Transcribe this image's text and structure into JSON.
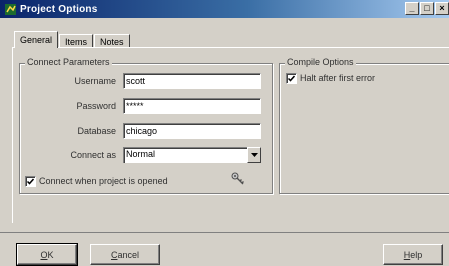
{
  "window": {
    "title": "Project Options",
    "min_glyph": "_",
    "max_glyph": "□",
    "close_glyph": "×"
  },
  "tabs": [
    {
      "label": "General"
    },
    {
      "label": "Items"
    },
    {
      "label": "Notes"
    }
  ],
  "connect_group": {
    "legend": "Connect Parameters",
    "username": {
      "label": "Username",
      "value": "scott"
    },
    "password": {
      "label": "Password",
      "value": "*****"
    },
    "database": {
      "label": "Database",
      "value": "chicago"
    },
    "connect_as": {
      "label": "Connect as",
      "value": "Normal"
    },
    "connect_on_open": {
      "label": "Connect when project is opened",
      "checked": true
    }
  },
  "compile_group": {
    "legend": "Compile Options",
    "halt_after_first_error": {
      "label": "Halt after first error",
      "checked": true
    }
  },
  "buttons": {
    "ok": {
      "first": "O",
      "rest": "K"
    },
    "cancel": {
      "first": "C",
      "rest": "ancel"
    },
    "help": {
      "first": "H",
      "rest": "elp"
    }
  },
  "icons": {
    "app": "project-icon",
    "test_connection": "key-icon"
  }
}
